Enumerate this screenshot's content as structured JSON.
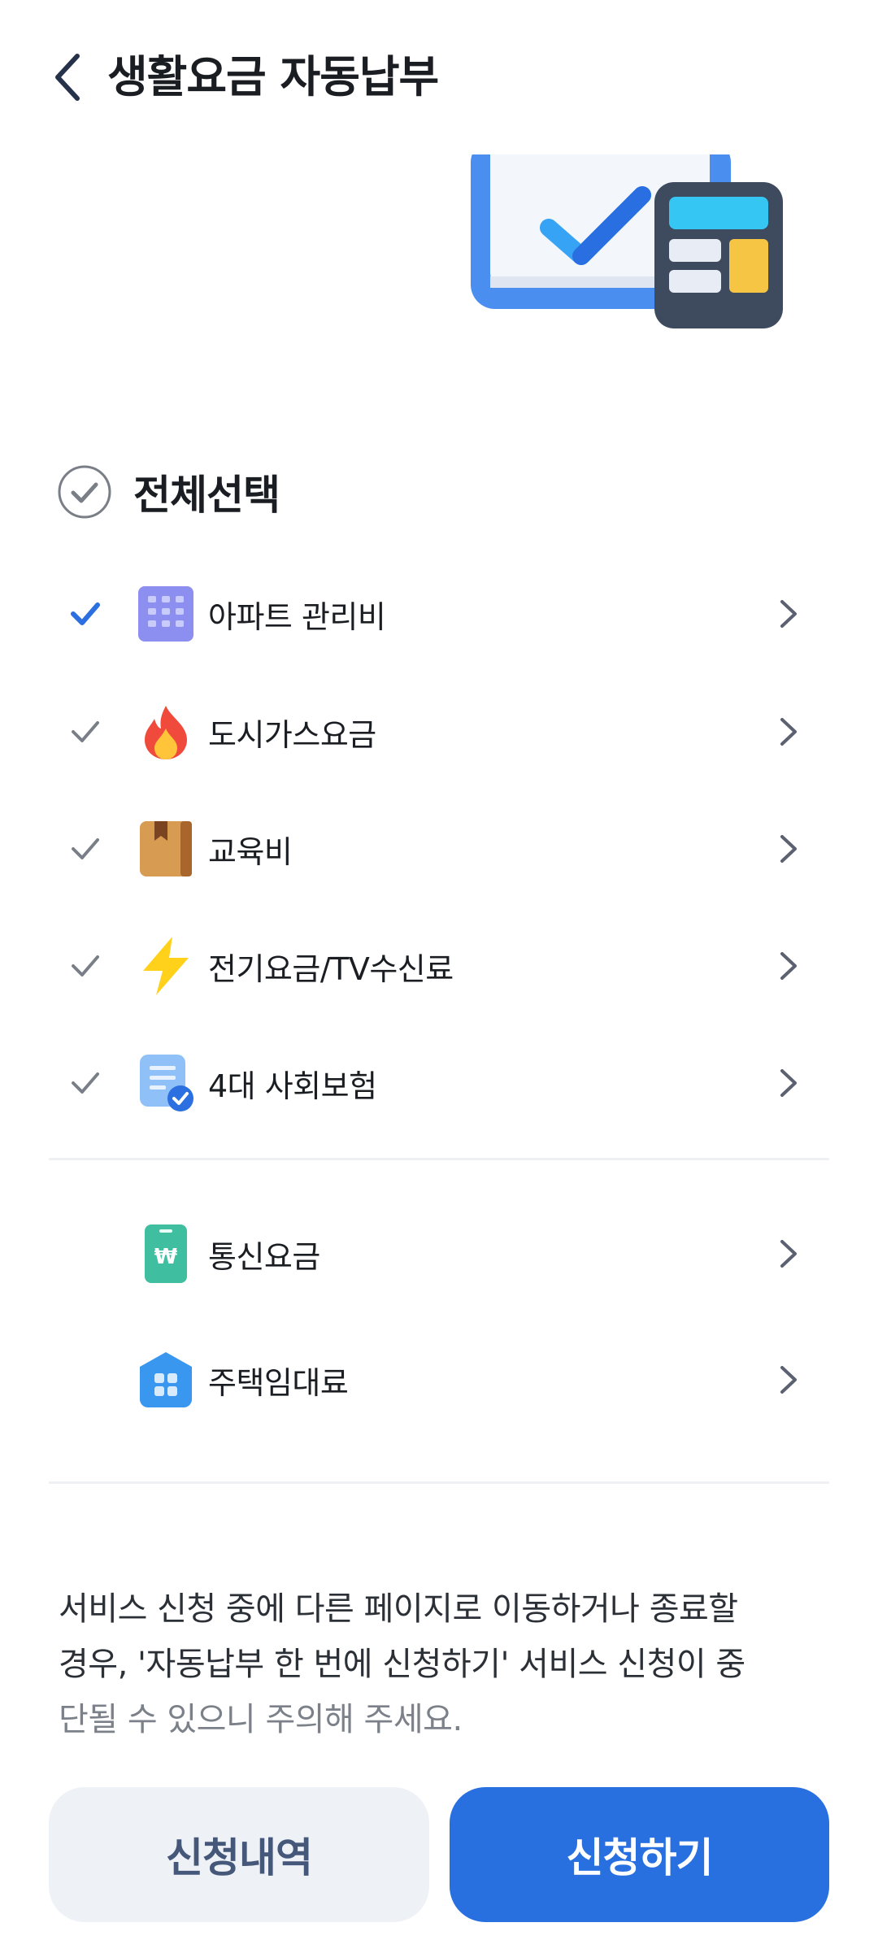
{
  "header": {
    "title": "생활요금 자동납부"
  },
  "select_all": {
    "label": "전체선택"
  },
  "bills": [
    {
      "label": "아파트 관리비",
      "checked": true,
      "icon": "apartment-icon"
    },
    {
      "label": "도시가스요금",
      "checked": true,
      "icon": "fire-icon"
    },
    {
      "label": "교육비",
      "checked": true,
      "icon": "book-icon"
    },
    {
      "label": "전기요금/TV수신료",
      "checked": true,
      "icon": "lightning-icon"
    },
    {
      "label": "4대 사회보험",
      "checked": true,
      "icon": "insurance-doc-icon"
    }
  ],
  "other_bills": [
    {
      "label": "통신요금",
      "icon": "phone-won-icon"
    },
    {
      "label": "주택임대료",
      "icon": "house-icon"
    }
  ],
  "notice": {
    "line1": "서비스 신청 중에 다른 페이지로 이동하거나 종료할",
    "line2": "경우, '자동납부 한 번에 신청하기' 서비스 신청이 중",
    "line3": "단될 수 있으니 주의해 주세요."
  },
  "buttons": {
    "history": "신청내역",
    "apply": "신청하기"
  },
  "colors": {
    "accent": "#2870e0",
    "check_active": "#2b6fe0",
    "check_inactive": "#7a7f87",
    "secondary_button_bg": "#eef1f6"
  }
}
